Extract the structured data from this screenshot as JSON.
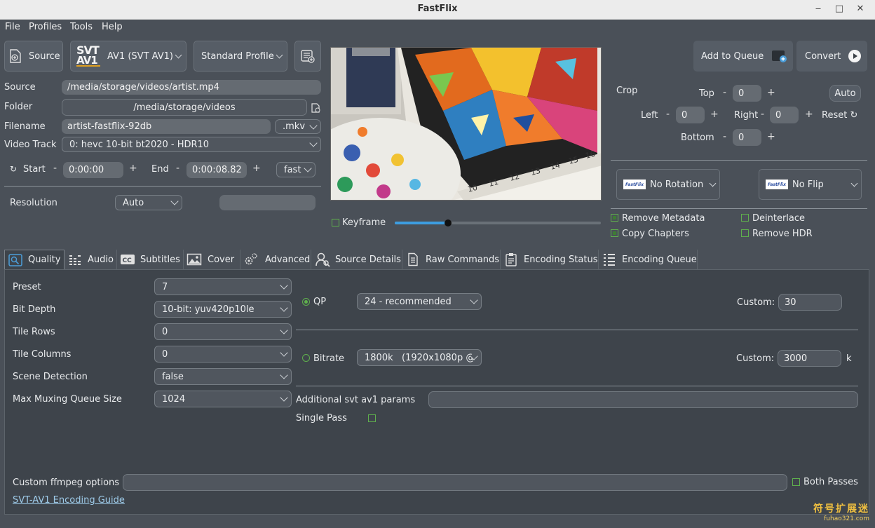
{
  "window": {
    "title": "FastFlix"
  },
  "menu": [
    "File",
    "Profiles",
    "Tools",
    "Help"
  ],
  "toolbar": {
    "source_label": "Source",
    "encoder_logo_top": "SVT",
    "encoder_logo_bottom": "AV1",
    "encoder": "AV1 (SVT AV1)",
    "profile": "Standard Profile",
    "add_to_queue": "Add to Queue",
    "convert": "Convert"
  },
  "form": {
    "source_label": "Source",
    "source_value": "/media/storage/videos/artist.mp4",
    "folder_label": "Folder",
    "folder_value": "/media/storage/videos",
    "filename_label": "Filename",
    "filename_value": "artist-fastflix-92db",
    "extension": ".mkv",
    "video_track_label": "Video Track",
    "video_track_value": "0: hevc 10-bit bt2020 - HDR10",
    "start_label": "Start",
    "start_value": "0:00:00",
    "end_label": "End",
    "end_value": "0:00:08.82",
    "seek_mode": "fast",
    "resolution_label": "Resolution",
    "resolution_value": "Auto"
  },
  "preview": {
    "keyframe_label": "Keyframe",
    "slider_position": 0.26,
    "ruler_numbers": [
      "10",
      "11",
      "12",
      "13",
      "14",
      "15",
      "16"
    ]
  },
  "crop": {
    "label": "Crop",
    "top_label": "Top",
    "top": "0",
    "left_label": "Left",
    "left": "0",
    "right_label": "Right",
    "right": "0",
    "bottom_label": "Bottom",
    "bottom": "0",
    "auto": "Auto",
    "reset": "Reset"
  },
  "transform": {
    "rotation_logo": "FastFlix",
    "rotation": "No Rotation",
    "flip_logo": "FastFlix",
    "flip": "No Flip"
  },
  "options": {
    "remove_metadata": "Remove Metadata",
    "copy_chapters": "Copy Chapters",
    "deinterlace": "Deinterlace",
    "remove_hdr": "Remove HDR"
  },
  "tabs": [
    "Quality",
    "Audio",
    "Subtitles",
    "Cover",
    "Advanced",
    "Source Details",
    "Raw Commands",
    "Encoding Status",
    "Encoding Queue"
  ],
  "quality": {
    "preset_label": "Preset",
    "preset": "7",
    "bit_depth_label": "Bit Depth",
    "bit_depth": "10-bit: yuv420p10le",
    "tile_rows_label": "Tile Rows",
    "tile_rows": "0",
    "tile_columns_label": "Tile Columns",
    "tile_columns": "0",
    "scene_detection_label": "Scene Detection",
    "scene_detection": "false",
    "max_muxing_label": "Max Muxing Queue Size",
    "max_muxing": "1024",
    "qp_label": "QP",
    "qp_value": "24 - recommended",
    "custom_label": "Custom:",
    "qp_custom": "30",
    "bitrate_label": "Bitrate",
    "bitrate_value": "1800k   (1920x1080p @",
    "bitrate_custom": "3000",
    "bitrate_unit": "k",
    "additional_label": "Additional svt av1 params",
    "single_pass_label": "Single Pass",
    "custom_ffmpeg_label": "Custom ffmpeg options",
    "both_passes_label": "Both Passes",
    "guide_link": "SVT-AV1 Encoding Guide"
  },
  "watermark": {
    "line1": "符号扩展迷",
    "line2": "fuhao321.com"
  }
}
